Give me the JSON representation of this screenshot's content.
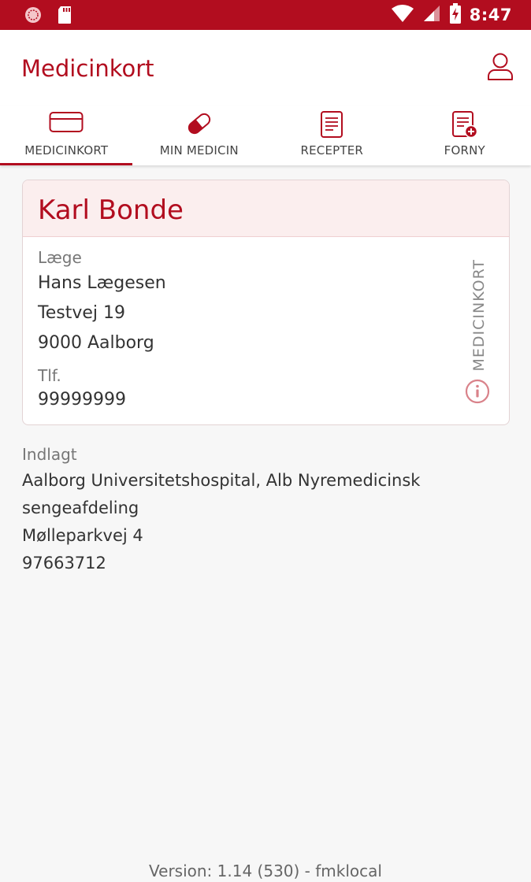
{
  "status_bar": {
    "time": "8:47",
    "icons": [
      "app-notification-icon",
      "sd-card-icon",
      "wifi-icon",
      "signal-icon",
      "battery-charging-icon"
    ]
  },
  "app_bar": {
    "title": "Medicinkort",
    "profile_icon": "person-icon"
  },
  "tabs": [
    {
      "label": "MEDICINKORT",
      "icon": "card-icon",
      "active": true
    },
    {
      "label": "MIN MEDICIN",
      "icon": "pill-icon",
      "active": false
    },
    {
      "label": "RECEPTER",
      "icon": "prescription-icon",
      "active": false
    },
    {
      "label": "FORNY",
      "icon": "renew-prescription-icon",
      "active": false
    }
  ],
  "card": {
    "patient_name": "Karl Bonde",
    "doctor_label": "Læge",
    "doctor_name": "Hans Lægesen",
    "doctor_street": "Testvej 19",
    "doctor_city": "9000 Aalborg",
    "phone_label": "Tlf.",
    "phone": "99999999",
    "side_label": "MEDICINKORT",
    "info_icon": "info-icon"
  },
  "admission": {
    "label": "Indlagt",
    "hospital": "Aalborg Universitetshospital, Alb Nyremedicinsk sengeafdeling",
    "street": "Mølleparkvej 4",
    "phone": "97663712"
  },
  "footer": {
    "version": "Version: 1.14 (530) - fmklocal"
  },
  "colors": {
    "brand": "#b20d1f",
    "card_header_bg": "#fbeeee",
    "background": "#f7f7f7"
  }
}
